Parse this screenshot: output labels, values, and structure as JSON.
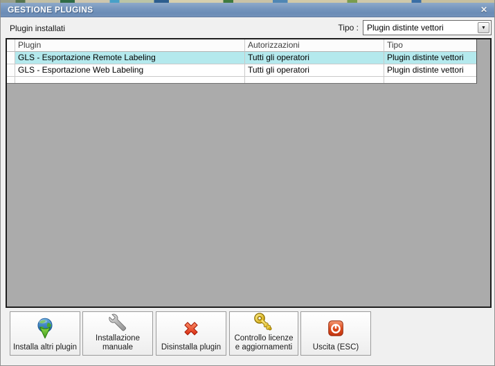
{
  "window": {
    "title": "GESTIONE PLUGINS",
    "close_glyph": "✕"
  },
  "header": {
    "installed_label": "Plugin installati",
    "type_label": "Tipo :",
    "type_value": "Plugin distinte vettori",
    "combo_arrow_glyph": "▼"
  },
  "table": {
    "columns": [
      "Plugin",
      "Autorizzazioni",
      "Tipo"
    ],
    "rows": [
      {
        "plugin": "GLS - Esportazione Remote Labeling",
        "autorizzazioni": "Tutti gli operatori",
        "tipo": "Plugin distinte vettori",
        "selected": true
      },
      {
        "plugin": "GLS - Esportazione Web Labeling",
        "autorizzazioni": "Tutti gli operatori",
        "tipo": "Plugin distinte vettori",
        "selected": false
      },
      {
        "plugin": "",
        "autorizzazioni": "",
        "tipo": "",
        "selected": false
      }
    ]
  },
  "buttons": [
    {
      "label": "Installa altri plugin",
      "icon": "globe-download-icon"
    },
    {
      "label": "Installazione manuale",
      "icon": "wrench-icon"
    },
    {
      "label": "Disinstalla plugin",
      "icon": "red-x-icon"
    },
    {
      "label": "Controllo licenze e aggiornamenti",
      "icon": "key-icon"
    },
    {
      "label": "Uscita (ESC)",
      "icon": "power-icon"
    }
  ],
  "theme": {
    "titlebar_blue": "#7495bd",
    "selected_row_cyan": "#b4e9ed",
    "panel_gray": "#ababab",
    "bar_background": "#f0f0f0",
    "grid_line": "#c9c9c9"
  }
}
